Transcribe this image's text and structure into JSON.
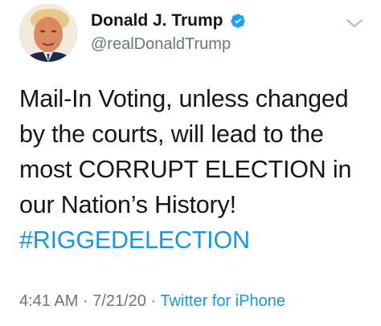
{
  "author": {
    "display_name": "Donald J. Trump",
    "handle": "@realDonaldTrump",
    "verified": true,
    "avatar_icon": "profile-photo"
  },
  "menu_icon": "chevron-down-icon",
  "tweet": {
    "lines": [
      "Mail-In Voting, unless changed",
      "by the courts, will lead to the",
      "most CORRUPT ELECTION in",
      "our Nation’s History!"
    ],
    "hashtag": "#RIGGEDELECTION"
  },
  "meta": {
    "time": "4:41 AM",
    "separator1": " · ",
    "date": "7/21/20",
    "separator2": " · ",
    "source": "Twitter for iPhone"
  },
  "colors": {
    "link": "#1b95e0",
    "secondary": "#657786",
    "text": "#14171a",
    "verified": "#1da1f2"
  }
}
